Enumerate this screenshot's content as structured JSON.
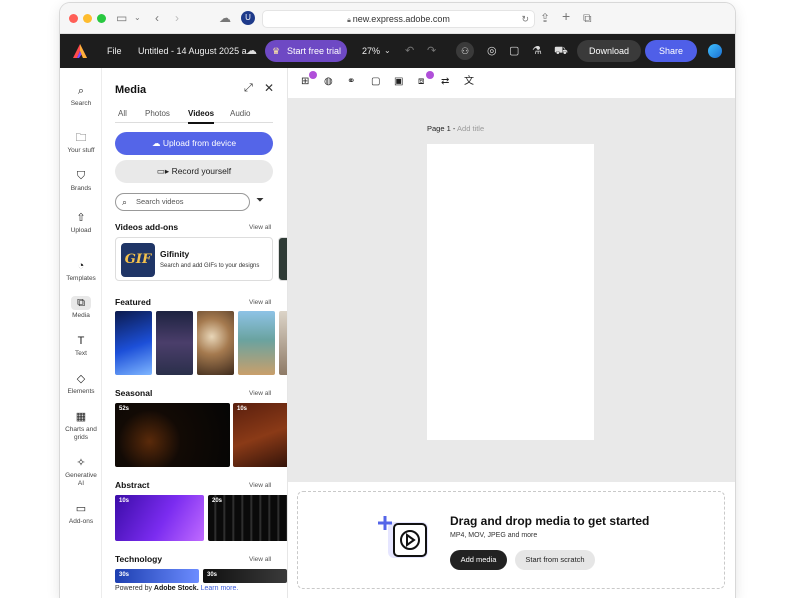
{
  "browser": {
    "url": "new.express.adobe.com",
    "profile_initial": "U"
  },
  "app": {
    "file_label": "File",
    "doc_title": "Untitled - 14 August 2025 a...",
    "trial_label": "Start free trial",
    "zoom": "27%",
    "download_label": "Download",
    "share_label": "Share",
    "accent": "#5465e8",
    "trial_color": "#6e49c4"
  },
  "rail": {
    "items": [
      {
        "label": "Search",
        "icon": "search-icon"
      },
      {
        "label": "Your stuff",
        "icon": "folder-icon"
      },
      {
        "label": "Brands",
        "icon": "brand-icon"
      },
      {
        "label": "Upload",
        "icon": "upload-icon"
      },
      {
        "label": "Templates",
        "icon": "templates-icon"
      },
      {
        "label": "Media",
        "icon": "media-icon"
      },
      {
        "label": "Text",
        "icon": "text-icon"
      },
      {
        "label": "Elements",
        "icon": "elements-icon"
      },
      {
        "label": "Charts and",
        "label2": "grids",
        "icon": "chart-icon"
      },
      {
        "label": "Generative",
        "label2": "AI",
        "icon": "ai-icon"
      },
      {
        "label": "Add-ons",
        "icon": "addons-icon"
      }
    ]
  },
  "panel": {
    "title": "Media",
    "tabs": [
      "All",
      "Photos",
      "Videos",
      "Audio"
    ],
    "active_tab": "Videos",
    "upload_label": "Upload from device",
    "record_label": "Record yourself",
    "search_placeholder": "Search videos",
    "addons_title": "Videos add-ons",
    "view_all": "View all",
    "addon": {
      "name": "Gifinity",
      "desc": "Search and add GIFs to your designs",
      "logo_text": "GIF"
    },
    "featured_title": "Featured",
    "seasonal_title": "Seasonal",
    "seasonal_durations": [
      "52s",
      "10s"
    ],
    "abstract_title": "Abstract",
    "abstract_durations": [
      "10s",
      "20s"
    ],
    "technology_title": "Technology",
    "technology_durations": [
      "30s",
      "30s"
    ],
    "footer_prefix": "Powered by",
    "footer_brand": "Adobe Stock.",
    "footer_link": "Learn more."
  },
  "canvas": {
    "page_label": "Page 1 -",
    "page_title_placeholder": "Add title",
    "drop_title": "Drag and drop media to get started",
    "drop_formats": "MP4, MOV, JPEG and more",
    "add_media_label": "Add media",
    "start_scratch_label": "Start from scratch"
  }
}
